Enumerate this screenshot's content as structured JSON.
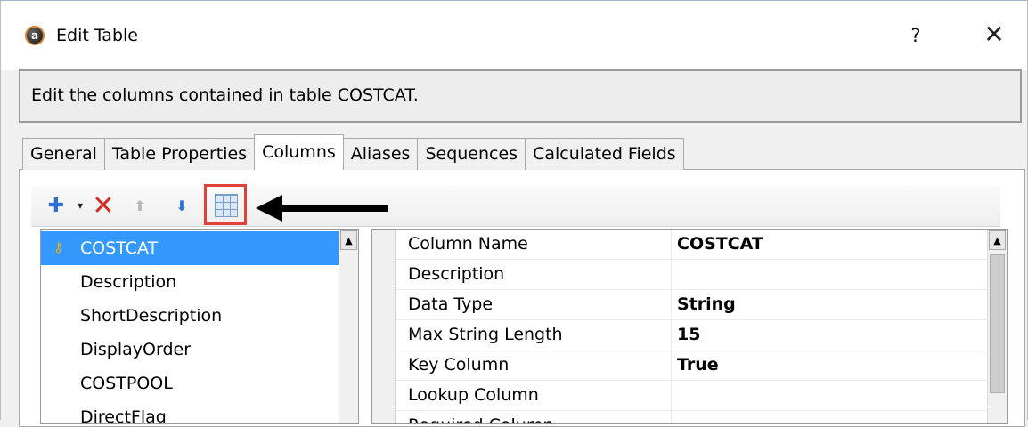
{
  "window": {
    "title": "Edit Table",
    "icon": "app-logo-icon",
    "icon_glyph": "a",
    "help_label": "?",
    "close_label": "✕"
  },
  "description": "Edit the columns contained in table COSTCAT.",
  "tabs": [
    {
      "label": "General",
      "active": false
    },
    {
      "label": "Table Properties",
      "active": false
    },
    {
      "label": "Columns",
      "active": true
    },
    {
      "label": "Aliases",
      "active": false
    },
    {
      "label": "Sequences",
      "active": false
    },
    {
      "label": "Calculated Fields",
      "active": false
    }
  ],
  "toolbar": {
    "icons": [
      "add-icon",
      "dropdown-arrow-icon",
      "delete-icon",
      "move-up-icon",
      "move-down-icon",
      "grid-view-icon"
    ],
    "highlight_color": "#e0413b",
    "annotation": "arrow pointing at grid-view-icon"
  },
  "column_list": {
    "items": [
      {
        "label": "COSTCAT",
        "selected": true,
        "key": true
      },
      {
        "label": "Description",
        "selected": false,
        "key": false
      },
      {
        "label": "ShortDescription",
        "selected": false,
        "key": false
      },
      {
        "label": "DisplayOrder",
        "selected": false,
        "key": false
      },
      {
        "label": "COSTPOOL",
        "selected": false,
        "key": false
      },
      {
        "label": "DirectFlag",
        "selected": false,
        "key": false
      }
    ],
    "selection_color": "#3399ff"
  },
  "properties": [
    {
      "name": "Column Name",
      "value": "COSTCAT"
    },
    {
      "name": "Description",
      "value": ""
    },
    {
      "name": "Data Type",
      "value": "String"
    },
    {
      "name": "Max String Length",
      "value": "15"
    },
    {
      "name": "Key Column",
      "value": "True"
    },
    {
      "name": "Lookup Column",
      "value": ""
    },
    {
      "name": "Required Column",
      "value": ""
    }
  ]
}
